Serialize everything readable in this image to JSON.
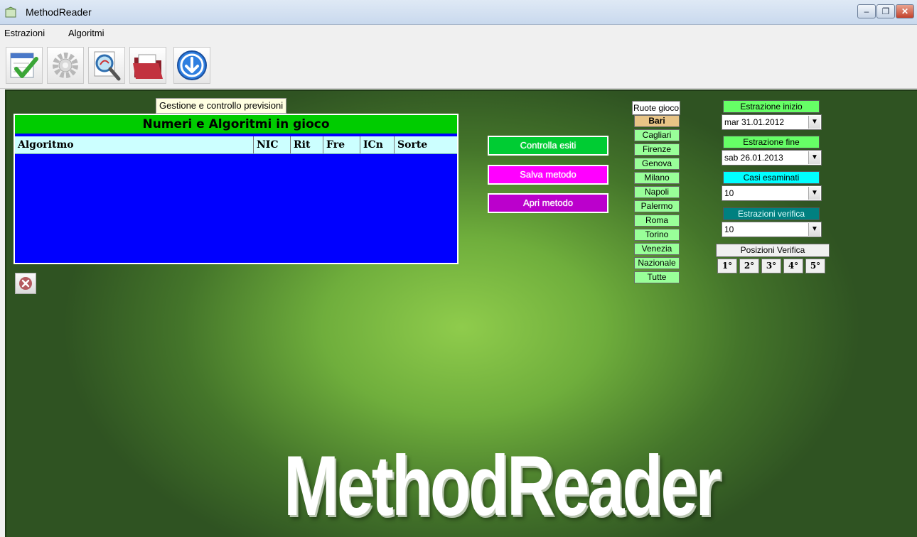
{
  "window": {
    "title": "MethodReader",
    "minimize": "–",
    "maximize": "❐",
    "close": "✕"
  },
  "menu": {
    "items": [
      "Estrazioni",
      "Algoritmi"
    ]
  },
  "toolbar": {
    "icons": [
      "checklist-icon",
      "gear-icon",
      "search-icon",
      "folder-icon",
      "download-arrow-icon"
    ]
  },
  "main": {
    "tooltip": "Gestione e controllo previsioni",
    "grid": {
      "title": "Numeri e Algoritmi in gioco",
      "columns": [
        "Algoritmo",
        "NIC",
        "Rit",
        "Fre",
        "ICn",
        "Sorte"
      ]
    },
    "buttons": {
      "controlla": "Controlla esiti",
      "salva": "Salva metodo",
      "apri": "Apri metodo"
    },
    "wheels": {
      "header": "Ruote gioco",
      "items": [
        "Bari",
        "Cagliari",
        "Firenze",
        "Genova",
        "Milano",
        "Napoli",
        "Palermo",
        "Roma",
        "Torino",
        "Venezia",
        "Nazionale",
        "Tutte"
      ],
      "selected": "Bari"
    },
    "settings": {
      "estrazione_inizio_label": "Estrazione inizio",
      "estrazione_inizio_value": "mar 31.01.2012",
      "estrazione_fine_label": "Estrazione fine",
      "estrazione_fine_value": "sab 26.01.2013",
      "casi_label": "Casi esaminati",
      "casi_value": "10",
      "verifica_label": "Estrazioni verifica",
      "verifica_value": "10",
      "posizioni_label": "Posizioni Verifica",
      "posizioni": [
        "1°",
        "2°",
        "3°",
        "4°",
        "5°"
      ]
    },
    "logo_text": "MethodReader"
  },
  "colors": {
    "grid_bg": "#0000ff",
    "grid_title_bg": "#00cc00",
    "grid_head_bg": "#ccffff",
    "controlla_bg": "#00cc33",
    "salva_bg": "#ff00ff",
    "apri_bg": "#bb00cc",
    "wheel_bg": "#99ff99",
    "inizio_bg": "#66ff66",
    "fine_bg": "#66ff66",
    "casi_bg": "#00ffff",
    "verifica_bg": "#008080"
  }
}
